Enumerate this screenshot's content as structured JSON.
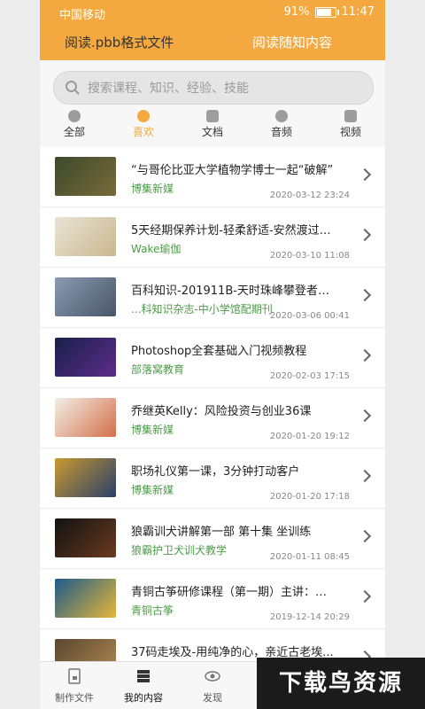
{
  "status": {
    "carrier": "中国移动",
    "battery": "91%",
    "battery_level": 0.91,
    "time": "11:47"
  },
  "tabs": {
    "active": "阅读.pbb格式文件",
    "inactive": "阅读随知内容"
  },
  "search": {
    "placeholder": "搜索课程、知识、经验、技能"
  },
  "categories": [
    "全部",
    "喜欢",
    "文档",
    "音频",
    "视频"
  ],
  "items": [
    {
      "title": "“与哥伦比亚大学植物学博士一起“破解”",
      "source": "博集新媒",
      "date": "2020-03-12 23:24"
    },
    {
      "title": "5天经期保养计划-轻柔舒适-安然渡过生...",
      "source": "Wake瑜伽",
      "date": "2020-03-10 11:08"
    },
    {
      "title": "百科知识-201911B-天时珠峰攀登者的...",
      "source": "...科知识杂志-中小学馆配期刊",
      "date": "2020-03-06 00:41"
    },
    {
      "title": "Photoshop全套基础入门视频教程",
      "source": "部落窝教育",
      "date": "2020-02-03 17:15"
    },
    {
      "title": "乔继英Kelly：风险投资与创业36课",
      "source": "博集新媒",
      "date": "2020-01-20 19:12"
    },
    {
      "title": "职场礼仪第一课，3分钟打动客户",
      "source": "博集新媒",
      "date": "2020-01-20 17:18"
    },
    {
      "title": "狼霸训犬讲解第一部 第十集  坐训练",
      "source": "狼霸护卫犬训犬教学",
      "date": "2020-01-11 08:45"
    },
    {
      "title": "青铜古筝研修课程（第一期）主讲：李晗",
      "source": "青铜古筝",
      "date": "2019-12-14 20:29"
    },
    {
      "title": "37码走埃及-用纯净的心，亲近古老埃...",
      "source": "",
      "date": ""
    }
  ],
  "nav": [
    "制作文件",
    "我的内容",
    "发现"
  ],
  "watermark": "下载鸟资源",
  "colors": {
    "accent": "#f3a93f",
    "source": "#4b9d47"
  }
}
